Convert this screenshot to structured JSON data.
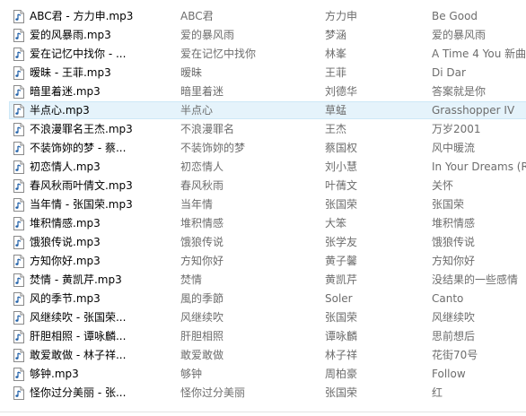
{
  "rows": [
    {
      "name": "ABC君 - 方力申.mp3",
      "title": "ABC君",
      "artist": "方力申",
      "album": "Be Good"
    },
    {
      "name": "爱的风暴雨.mp3",
      "title": "爱的暴风雨",
      "artist": "梦涵",
      "album": "爱的暴风雨"
    },
    {
      "name": "爱在记忆中找你 - ...",
      "title": "爱在记忆中找你",
      "artist": "林峯",
      "album": "A Time 4 You 新曲"
    },
    {
      "name": "暧昧 - 王菲.mp3",
      "title": "暧昧",
      "artist": "王菲",
      "album": "Di Dar"
    },
    {
      "name": "暗里着迷.mp3",
      "title": "暗里着迷",
      "artist": "刘德华",
      "album": "答案就是你"
    },
    {
      "name": "半点心.mp3",
      "title": "半点心",
      "artist": "草蜢",
      "album": "Grasshopper IV"
    },
    {
      "name": "不浪漫罪名王杰.mp3",
      "title": "不浪漫罪名",
      "artist": "王杰",
      "album": "万岁2001"
    },
    {
      "name": "不装饰妳的梦 - 蔡...",
      "title": "不装饰妳的梦",
      "artist": "蔡国权",
      "album": "风中暖流"
    },
    {
      "name": "初恋情人.mp3",
      "title": "初恋情人",
      "artist": "刘小慧",
      "album": "In Your Dreams (R"
    },
    {
      "name": "春风秋雨叶倩文.mp3",
      "title": "春风秋雨",
      "artist": "叶蒨文",
      "album": "关怀"
    },
    {
      "name": "当年情 - 张国荣.mp3",
      "title": "当年情",
      "artist": "张国荣",
      "album": "张国荣"
    },
    {
      "name": "堆积情感.mp3",
      "title": "堆积情感",
      "artist": "大笨",
      "album": "堆积情感"
    },
    {
      "name": "饿狼传说.mp3",
      "title": "饿狼传说",
      "artist": "张学友",
      "album": "饿狼传说"
    },
    {
      "name": "方知你好.mp3",
      "title": "方知你好",
      "artist": "黄子馨",
      "album": "方知你好"
    },
    {
      "name": "焚情 - 黄凯芹.mp3",
      "title": "焚情",
      "artist": "黄凯芹",
      "album": "没结果的一些感情"
    },
    {
      "name": "风的季节.mp3",
      "title": "風的季節",
      "artist": "Soler",
      "album": "Canto"
    },
    {
      "name": "风继续吹 - 张国荣...",
      "title": "风继续吹",
      "artist": "张国荣",
      "album": "风继续吹"
    },
    {
      "name": "肝胆相照 - 谭咏麟...",
      "title": "肝胆相照",
      "artist": "谭咏麟",
      "album": "思前想后"
    },
    {
      "name": "敢爱敢做 - 林子祥...",
      "title": "敢爱敢做",
      "artist": "林子祥",
      "album": "花街70号"
    },
    {
      "name": "够钟.mp3",
      "title": "够钟",
      "artist": "周柏豪",
      "album": "Follow"
    },
    {
      "name": "怪你过分美丽 - 张...",
      "title": "怪你过分美丽",
      "artist": "张国荣",
      "album": "红"
    }
  ],
  "selected_row_index": 5,
  "colors": {
    "selection_bg": "#e5f3fb",
    "selection_border": "#cde8f7",
    "primary_text": "#000000",
    "secondary_text": "#6d6d6d",
    "icon_note": "#1f5fa8"
  },
  "icons": {
    "row_icon": "music-file-icon"
  }
}
